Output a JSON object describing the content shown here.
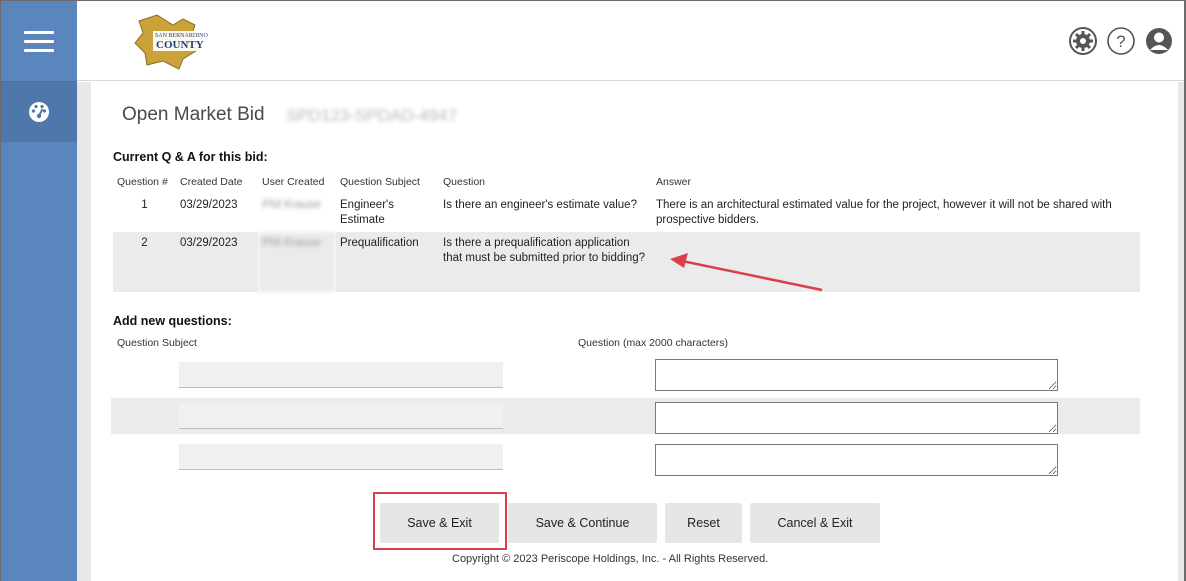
{
  "header": {
    "logo_top": "SAN BERNARDINO",
    "logo_main": "COUNTY",
    "icons": [
      "gear-icon",
      "help-icon",
      "user-icon"
    ]
  },
  "sidebar": {
    "icons": [
      "hamburger-menu-icon",
      "dashboard-icon"
    ]
  },
  "page": {
    "title": "Open Market Bid",
    "bid_id": "SPD123-SPDAD-4947"
  },
  "qa": {
    "heading": "Current Q & A for this bid:",
    "columns": [
      "Question #",
      "Created Date",
      "User Created",
      "Question Subject",
      "Question",
      "Answer"
    ],
    "rows": [
      {
        "num": "1",
        "date": "03/29/2023",
        "user": "Phil Krause",
        "subject": "Engineer's Estimate",
        "question": "Is there an engineer's estimate value?",
        "answer": "There is an architectural estimated value for the project, however it will not be shared with prospective bidders."
      },
      {
        "num": "2",
        "date": "03/29/2023",
        "user": "Phil Krause",
        "subject": "Prequalification",
        "question": "Is there a prequalification application that must be submitted prior to bidding?",
        "answer": ""
      }
    ]
  },
  "add_new": {
    "heading": "Add new questions:",
    "subject_label": "Question Subject",
    "question_label": "Question (max 2000 characters)"
  },
  "buttons": {
    "save_exit": "Save & Exit",
    "save_continue": "Save & Continue",
    "reset": "Reset",
    "cancel_exit": "Cancel & Exit"
  },
  "footer": {
    "copyright": "Copyright © 2023 Periscope Holdings, Inc. - All Rights Reserved."
  },
  "colors": {
    "sidebar": "#5b86bd",
    "annotation_red": "#d9404a"
  }
}
